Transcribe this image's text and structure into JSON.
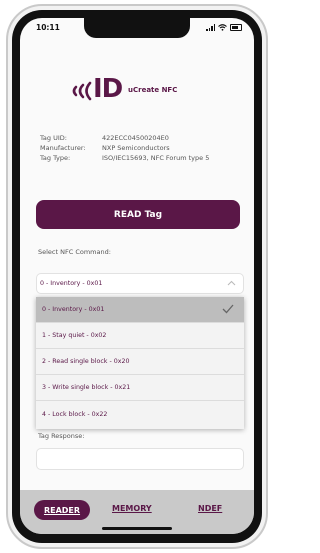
{
  "status_bar": {
    "time": "10:11"
  },
  "logo": {
    "mark": "ID",
    "text": "uCreate NFC"
  },
  "tag_info": [
    {
      "key": "Tag UID:",
      "value": "422ECC04500204E0"
    },
    {
      "key": "Manufacturer:",
      "value": "NXP Semiconductors"
    },
    {
      "key": "Tag Type:",
      "value": "ISO/IEC15693, NFC Forum type 5"
    }
  ],
  "read_button": "READ Tag",
  "command": {
    "label": "Select NFC Command:",
    "selected": "0 - Inventory - 0x01",
    "options": [
      "0 - Inventory - 0x01",
      "1 - Stay quiet - 0x02",
      "2 - Read single block - 0x20",
      "3 - Write single block - 0x21",
      "4 - Lock block - 0x22"
    ]
  },
  "response": {
    "label": "Tag Response:",
    "value": ""
  },
  "tabs": [
    "READER",
    "MEMORY",
    "NDEF"
  ],
  "colors": {
    "brand": "#5a1747",
    "tabbar": "#c9c9c9"
  },
  "icons": [
    "nfc-waves-icon",
    "signal-icon",
    "wifi-icon",
    "battery-icon",
    "chevron-up-icon",
    "checkmark-icon"
  ]
}
